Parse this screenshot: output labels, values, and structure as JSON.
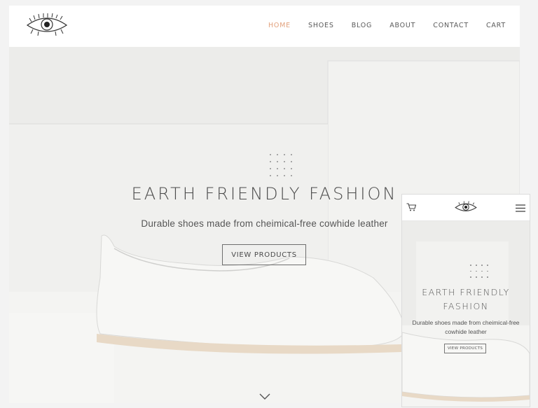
{
  "desktop": {
    "nav": [
      {
        "label": "HOME",
        "active": true
      },
      {
        "label": "SHOES",
        "active": false
      },
      {
        "label": "BLOG",
        "active": false
      },
      {
        "label": "ABOUT",
        "active": false
      },
      {
        "label": "CONTACT",
        "active": false
      },
      {
        "label": "CART",
        "active": false
      }
    ],
    "hero": {
      "title": "EARTH FRIENDLY FASHION",
      "subtitle": "Durable shoes made from cheimical-free cowhide leather",
      "button": "VIEW PRODUCTS"
    }
  },
  "mobile": {
    "hero": {
      "title_line1": "EARTH FRIENDLY",
      "title_line2": "FASHION",
      "subtitle": "Durable shoes made from cheimical-free cowhide leather",
      "button": "VIEW PRODUCTS"
    }
  },
  "colors": {
    "accent": "#e2a17c",
    "text": "#4a4a4a",
    "background": "#eeeeec"
  },
  "icons": [
    "eye-logo-icon",
    "chevron-down-icon",
    "cart-icon",
    "hamburger-menu-icon"
  ]
}
